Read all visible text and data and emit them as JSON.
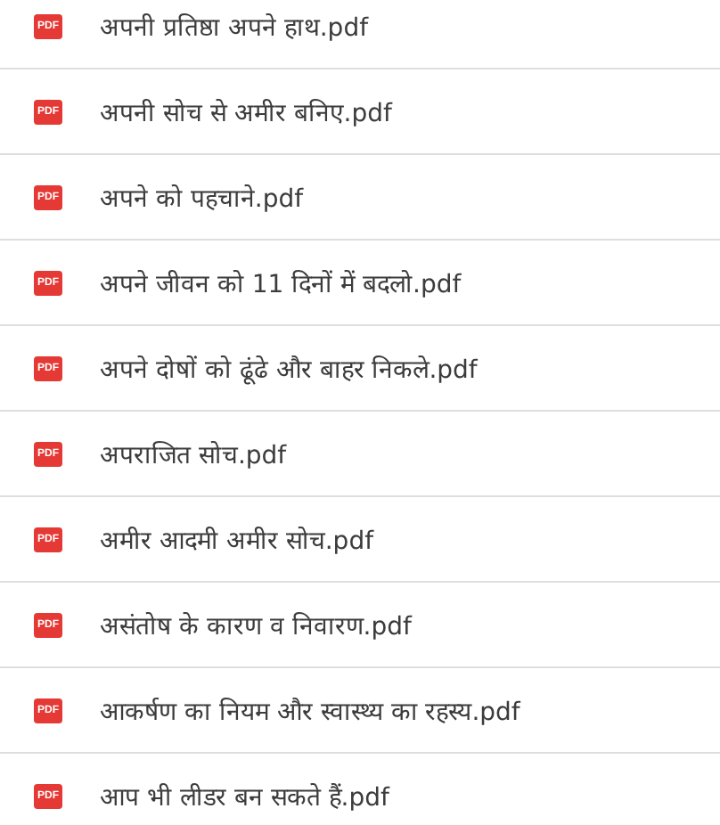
{
  "files": [
    {
      "badge": "PDF",
      "name": "अपनी प्रतिष्ठा अपने हाथ.pdf"
    },
    {
      "badge": "PDF",
      "name": "अपनी सोच से अमीर बनिए.pdf"
    },
    {
      "badge": "PDF",
      "name": "अपने को पहचाने.pdf"
    },
    {
      "badge": "PDF",
      "name": "अपने जीवन को 11 दिनों में बदलो.pdf"
    },
    {
      "badge": "PDF",
      "name": "अपने दोषों को ढूंढे और बाहर निकले.pdf"
    },
    {
      "badge": "PDF",
      "name": "अपराजित सोच.pdf"
    },
    {
      "badge": "PDF",
      "name": "अमीर आदमी अमीर सोच.pdf"
    },
    {
      "badge": "PDF",
      "name": "असंतोष के कारण व निवारण.pdf"
    },
    {
      "badge": "PDF",
      "name": "आकर्षण का नियम और स्वास्थ्य का रहस्य.pdf"
    },
    {
      "badge": "PDF",
      "name": "आप भी लीडर बन सकते हैं.pdf"
    }
  ]
}
